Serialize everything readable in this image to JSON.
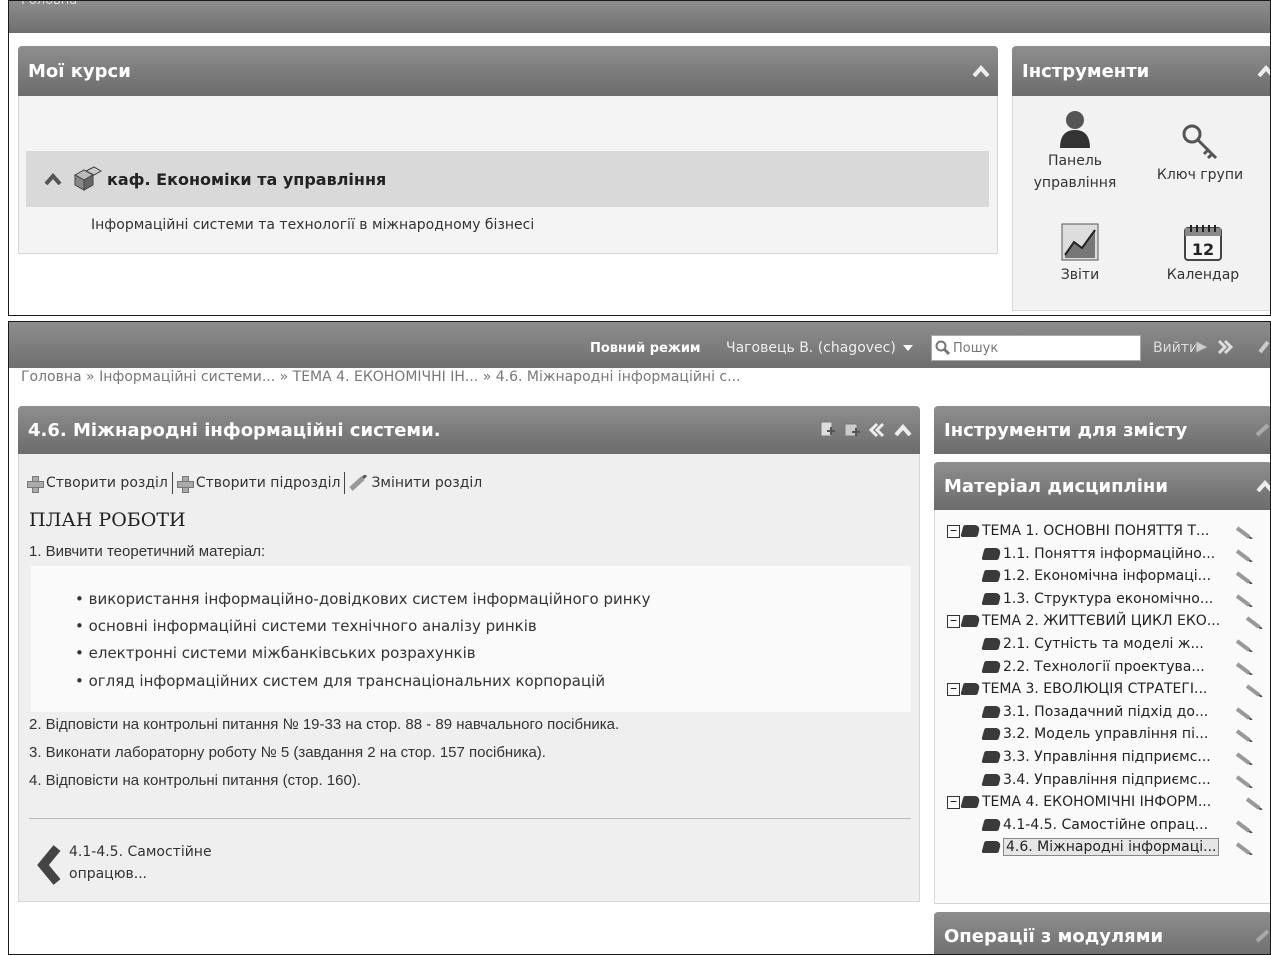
{
  "top_window": {
    "breadcrumb_home": "Головна",
    "my_courses": {
      "title": "Мої курси",
      "department": "каф. Економіки та управління",
      "course": "Інформаційні системи та технології в міжнародному бізнесі"
    },
    "tools": {
      "title": "Інструменти",
      "items": [
        {
          "label_line1": "Панель",
          "label_line2": "управління",
          "icon": "user-icon"
        },
        {
          "label": "Ключ групи",
          "icon": "key-icon"
        },
        {
          "label": "Звіти",
          "icon": "chart-icon"
        },
        {
          "label": "Календар",
          "icon": "calendar-icon",
          "calendar_day": "12"
        }
      ]
    }
  },
  "bottom_window": {
    "header": {
      "full_mode": "Повний режим",
      "user": "Чаговець В. (chagovec)",
      "search_placeholder": "Пошук",
      "logout": "Вийти"
    },
    "breadcrumb": "Головна » Інформаційні системи... » ТЕМА 4. ЕКОНОМІЧНІ ІН... » 4.6. Міжнародні інформаційні с...",
    "section": {
      "title": "4.6. Міжнародні інформаційні системи.",
      "actions": {
        "create_section": "Створити розділ",
        "create_subsection": "Створити підрозділ",
        "edit_section": "Змінити розділ"
      },
      "plan_heading": "ПЛАН РОБОТИ",
      "step1": "1. Вивчити теоретичний матеріал:",
      "bullets": [
        "використання інформаційно-довідкових систем інформаційного ринку",
        "основні інформаційні системи технічного аналізу ринків",
        "електронні системи міжбанківських розрахунків",
        "огляд інформаційних систем для транснаціональних корпорацій"
      ],
      "step2": "2. Відповісти на контрольні питання № 19-33 на стор. 88 - 89 навчального посібника.",
      "step3": "3. Виконати лабораторну роботу № 5 (завдання 2 на стор. 157 посібника).",
      "step4": "4. Відповісти на контрольні питання (стор. 160).",
      "prev_line1": "4.1-4.5. Самостійне",
      "prev_line2": "опрацюв..."
    },
    "sidebar": {
      "content_tools_title": "Інструменти для змісту",
      "material_title": "Матеріал дисципліни",
      "modules_title": "Операції з модулями",
      "tree": [
        {
          "label": "ТЕМА 1. ОСНОВНІ ПОНЯТТЯ Т...",
          "level": 0
        },
        {
          "label": "1.1. Поняття інформаційно...",
          "level": 1
        },
        {
          "label": "1.2. Економічна інформаці...",
          "level": 1
        },
        {
          "label": "1.3. Структура економічно...",
          "level": 1
        },
        {
          "label": "ТЕМА 2. ЖИТТЄВИЙ ЦИКЛ ЕКО...",
          "level": 0
        },
        {
          "label": "2.1. Сутність та моделі ж...",
          "level": 1
        },
        {
          "label": "2.2. Технології проектува...",
          "level": 1
        },
        {
          "label": "ТЕМА 3. ЕВОЛЮЦІЯ СТРАТЕГІ...",
          "level": 0
        },
        {
          "label": "3.1. Позадачний підхід до...",
          "level": 1
        },
        {
          "label": "3.2. Модель управління пі...",
          "level": 1
        },
        {
          "label": "3.3. Управління підприємс...",
          "level": 1
        },
        {
          "label": "3.4. Управління підприємс...",
          "level": 1
        },
        {
          "label": "ТЕМА 4. ЕКОНОМІЧНІ ІНФОРМ...",
          "level": 0
        },
        {
          "label": "4.1-4.5. Самостійне опрац...",
          "level": 1
        },
        {
          "label": "4.6. Міжнародні інформаці...",
          "level": 1,
          "selected": true
        }
      ]
    }
  }
}
